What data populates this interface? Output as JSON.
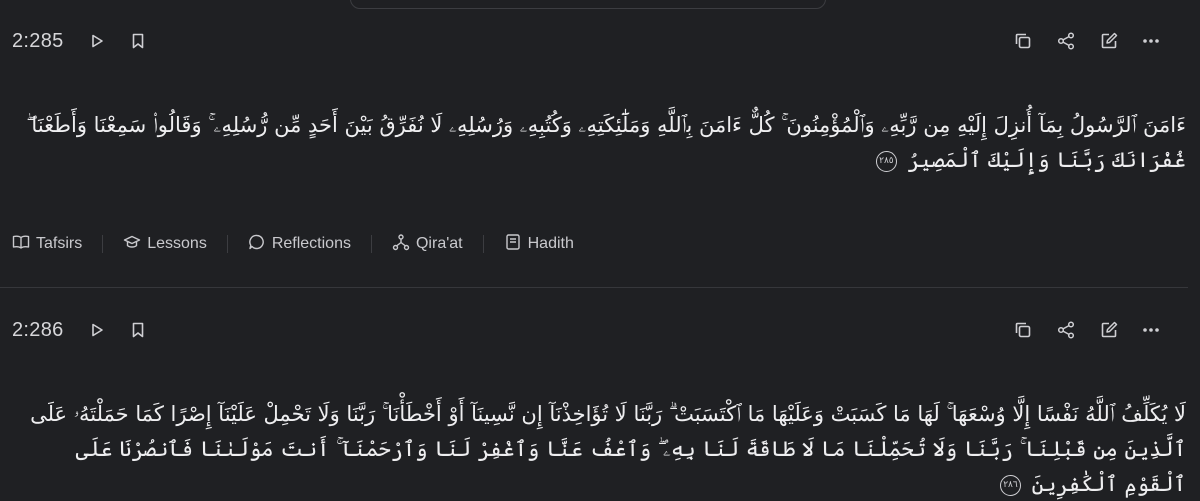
{
  "verses": [
    {
      "key": "2:285",
      "arabic_line1": "ءَامَنَ ٱلرَّسُولُ بِمَآ أُنزِلَ إِلَيْهِ مِن رَّبِّهِۦ وَٱلْمُؤْمِنُونَ ۚ كُلٌّ ءَامَنَ بِٱللَّهِ وَمَلَٰٓئِكَتِهِۦ وَكُتُبِهِۦ وَرُسُلِهِۦ لَا نُفَرِّقُ بَيْنَ أَحَدٍ مِّن رُّسُلِهِۦ ۚ وَقَالُوا۟ سَمِعْنَا وَأَطَعْنَا ۖ",
      "arabic_line2": "غُفْرَانَكَ رَبَّنَا وَإِلَيْكَ ٱلْمَصِيرُ",
      "end_marker": "٢٨٥"
    },
    {
      "key": "2:286",
      "arabic_line1": "لَا يُكَلِّفُ ٱللَّهُ نَفْسًا إِلَّا وُسْعَهَا ۚ لَهَا مَا كَسَبَتْ وَعَلَيْهَا مَا ٱكْتَسَبَتْ ۗ رَبَّنَا لَا تُؤَاخِذْنَآ إِن نَّسِينَآ أَوْ أَخْطَأْنَا ۚ رَبَّنَا وَلَا تَحْمِلْ عَلَيْنَآ إِصْرًا كَمَا حَمَلْتَهُۥ عَلَى",
      "arabic_line2": "ٱلَّذِينَ مِن قَبْلِنَا ۚ رَبَّنَا وَلَا تُحَمِّلْنَا مَا لَا طَاقَةَ لَنَا بِهِۦ ۖ وَٱعْفُ عَنَّا وَٱغْفِرْ لَنَا وَٱرْحَمْنَآ ۚ أَنتَ مَوْلَىٰنَا فَٱنصُرْنَا عَلَى ٱلْقَوْمِ ٱلْكَٰفِرِينَ",
      "end_marker": "٢٨٦"
    }
  ],
  "resources": {
    "tafsirs": "Tafsirs",
    "lessons": "Lessons",
    "reflections": "Reflections",
    "qiraat": "Qira'at",
    "hadith": "Hadith"
  },
  "icons": {
    "play": "play-icon",
    "bookmark": "bookmark-icon",
    "copy": "copy-icon",
    "share": "share-icon",
    "edit": "edit-icon",
    "more": "more-icon"
  },
  "colors": {
    "background": "#1f2023",
    "text": "#e8e8ea",
    "muted": "#c9c9cd",
    "divider": "#36373b"
  }
}
